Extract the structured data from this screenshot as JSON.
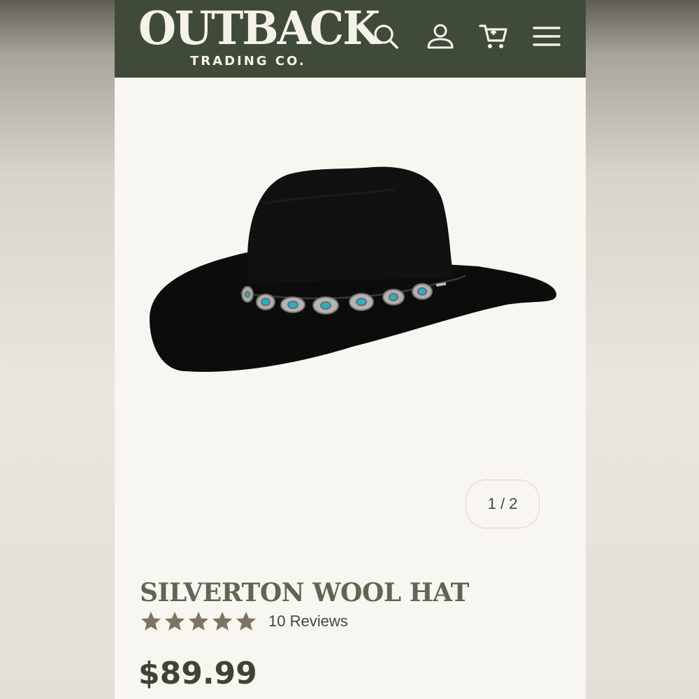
{
  "header": {
    "brand_name": "OUTBACK",
    "brand_sub": "TRADING CO.",
    "icons": [
      "search-icon",
      "account-icon",
      "cart-icon",
      "menu-icon"
    ],
    "colors": {
      "background": "#404a38",
      "text": "#f5f2ea"
    }
  },
  "carousel": {
    "counter": "1 / 2",
    "current": 1,
    "total": 2
  },
  "product": {
    "name": "SILVERTON WOOL HAT",
    "rating": 5,
    "rating_max": 5,
    "reviews_label": "10 Reviews",
    "price": "$89.99",
    "colors": {
      "title": "#5f6653",
      "stars": "#7d7560",
      "price": "#3d4532"
    }
  }
}
